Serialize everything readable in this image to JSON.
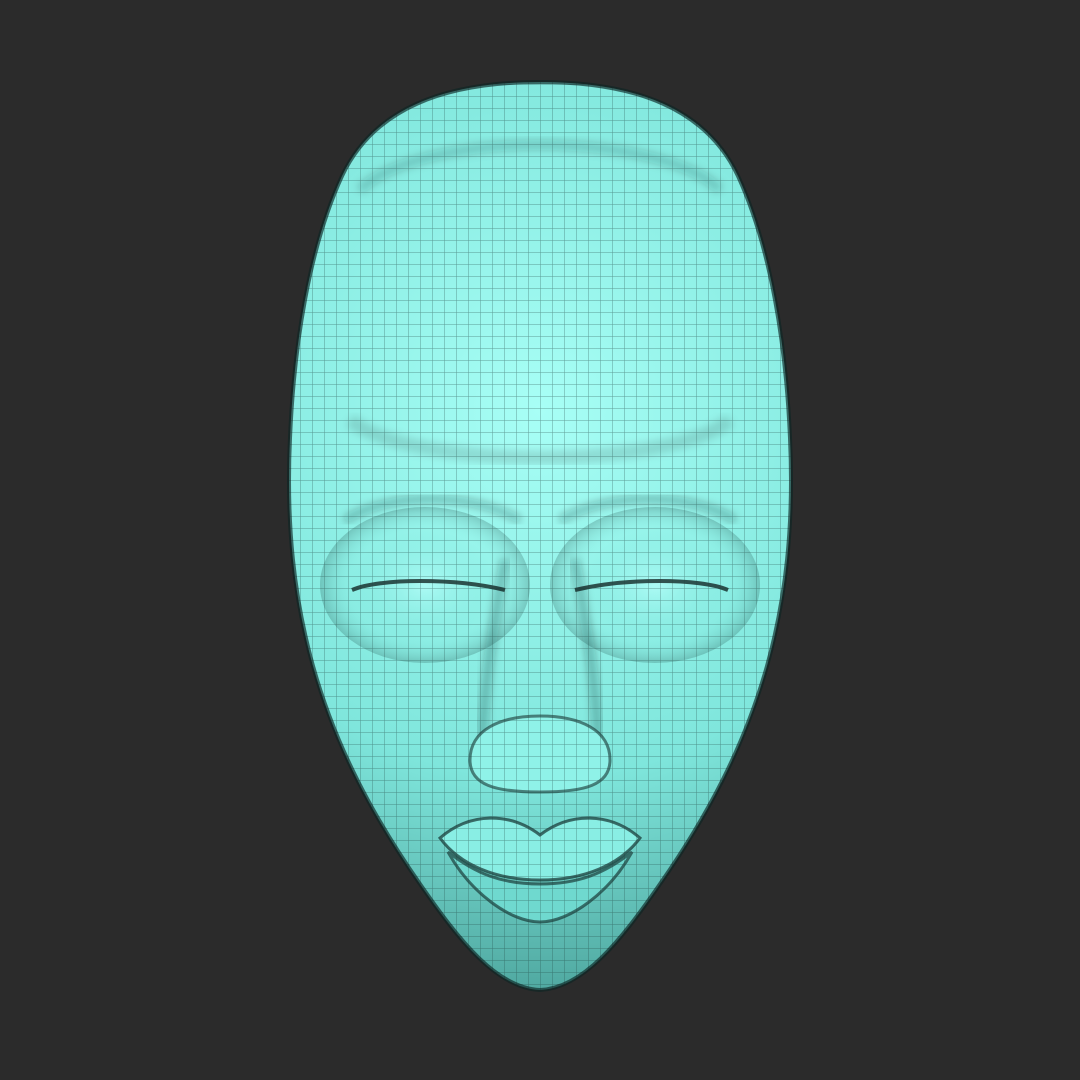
{
  "viewport": {
    "background_color": "#2b2b2b"
  },
  "model": {
    "subject": "face-mask",
    "render_style": "wireframe-over-shaded",
    "base_color": "#7fe6dc",
    "highlight_color": "#a8fff6",
    "shadow_color": "#3c8f88",
    "wire_color": "#1d3f3c",
    "eyes_state": "closed"
  }
}
